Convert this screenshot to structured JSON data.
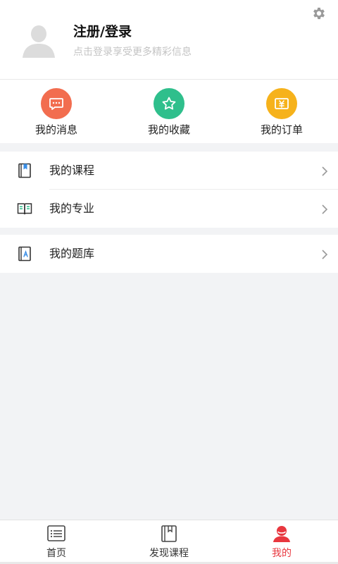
{
  "header": {
    "login_title": "注册/登录",
    "login_subtitle": "点击登录享受更多精彩信息",
    "settings_icon": "gear-icon",
    "avatar_icon": "default-avatar-icon"
  },
  "shortcuts": [
    {
      "label": "我的消息",
      "icon": "message-icon",
      "color": "#f26d4f"
    },
    {
      "label": "我的收藏",
      "icon": "star-icon",
      "color": "#2fbf8c"
    },
    {
      "label": "我的订单",
      "icon": "order-icon",
      "color": "#f6b21b"
    }
  ],
  "menu": {
    "group1": [
      {
        "label": "我的课程",
        "icon": "course-book-icon"
      },
      {
        "label": "我的专业",
        "icon": "major-book-icon"
      }
    ],
    "group2": [
      {
        "label": "我的题库",
        "icon": "question-bank-icon"
      }
    ]
  },
  "tabbar": [
    {
      "label": "首页",
      "icon": "home-list-icon",
      "active": false
    },
    {
      "label": "发现课程",
      "icon": "discover-book-icon",
      "active": false
    },
    {
      "label": "我的",
      "icon": "profile-icon",
      "active": true
    }
  ],
  "colors": {
    "accent": "#e8373f",
    "background": "#f2f3f5",
    "subtitle": "#c4c4c4"
  }
}
